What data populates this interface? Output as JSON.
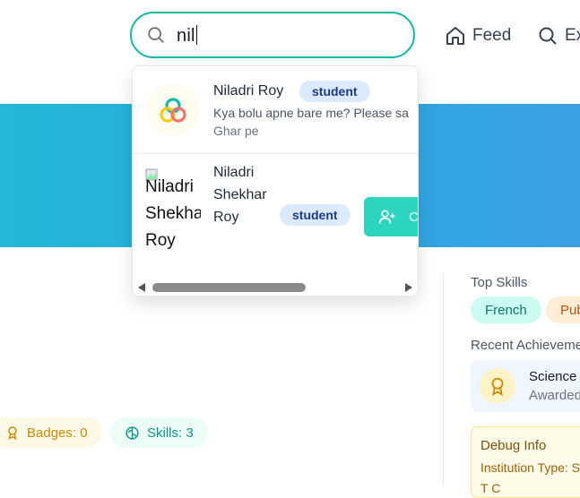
{
  "header": {
    "search": {
      "value": "nil"
    },
    "nav": [
      {
        "label": "Feed",
        "icon": "home-icon"
      },
      {
        "label": "Ex",
        "icon": "search-icon"
      }
    ]
  },
  "dropdown": {
    "results": [
      {
        "name": "Niladri Roy",
        "badge": "student",
        "bio": "Kya bolu apne bare me? Please sa",
        "location": "Ghar pe",
        "avatar": "rings-logo-icon"
      },
      {
        "name_lines": [
          "Niladri",
          "Shekhar",
          "Roy"
        ],
        "badge": "student",
        "avatar_alt_lines": [
          "Niladri",
          "Shekha",
          "Roy"
        ],
        "connect_icon": "add-user-icon",
        "connect_label": "C"
      }
    ]
  },
  "sidebar": {
    "top_skills_label": "Top Skills",
    "skills": [
      "French",
      "Pub"
    ],
    "recent_label": "Recent Achieveme",
    "achievement": {
      "title": "Science F",
      "subtitle": "Awarded",
      "icon": "award-icon"
    },
    "debug": {
      "title": "Debug Info",
      "line1": "Institution Type: S",
      "line2": "T      C"
    }
  },
  "stats": {
    "badges": "Badges: 0",
    "skills": "Skills: 3"
  },
  "colors": {
    "accent": "#14b8a6",
    "banner": "#2aa9df",
    "badge_bg": "#dbeafe"
  }
}
